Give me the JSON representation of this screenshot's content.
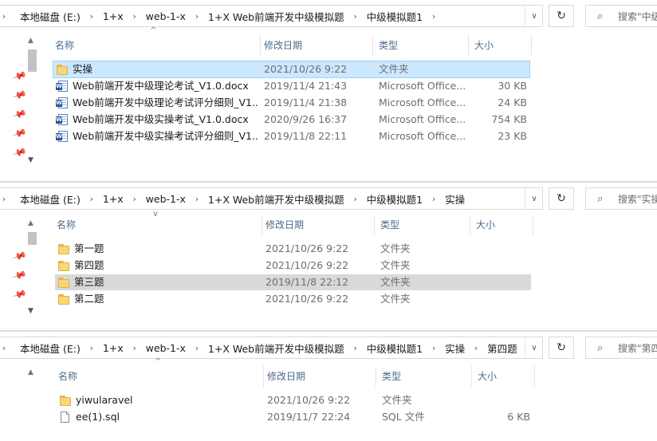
{
  "pane1": {
    "breadcrumb": [
      "本地磁盘 (E:)",
      "1+x",
      "web-1-x",
      "1+X Web前端开发中级模拟题",
      "中级模拟题1"
    ],
    "search_placeholder": "搜索\"中级",
    "columns": {
      "name": "名称",
      "date": "修改日期",
      "type": "类型",
      "size": "大小"
    },
    "rows": [
      {
        "icon": "folder",
        "name": "实操",
        "date": "2021/10/26 9:22",
        "type": "文件夹",
        "size": "",
        "state": "selected"
      },
      {
        "icon": "word",
        "name": "Web前端开发中级理论考试_V1.0.docx",
        "date": "2019/11/4 21:43",
        "type": "Microsoft Office...",
        "size": "30 KB",
        "state": ""
      },
      {
        "icon": "word",
        "name": "Web前端开发中级理论考试评分细则_V1...",
        "date": "2019/11/4 21:38",
        "type": "Microsoft Office...",
        "size": "24 KB",
        "state": ""
      },
      {
        "icon": "word",
        "name": "Web前端开发中级实操考试_V1.0.docx",
        "date": "2020/9/26 16:37",
        "type": "Microsoft Office...",
        "size": "754 KB",
        "state": ""
      },
      {
        "icon": "word",
        "name": "Web前端开发中级实操考试评分细则_V1...",
        "date": "2019/11/8 22:11",
        "type": "Microsoft Office...",
        "size": "23 KB",
        "state": ""
      }
    ]
  },
  "pane2": {
    "breadcrumb": [
      "本地磁盘 (E:)",
      "1+x",
      "web-1-x",
      "1+X Web前端开发中级模拟题",
      "中级模拟题1",
      "实操"
    ],
    "search_placeholder": "搜索\"实操",
    "columns": {
      "name": "名称",
      "date": "修改日期",
      "type": "类型",
      "size": "大小"
    },
    "rows": [
      {
        "icon": "folder",
        "name": "第一题",
        "date": "2021/10/26 9:22",
        "type": "文件夹",
        "size": "",
        "state": ""
      },
      {
        "icon": "folder",
        "name": "第四题",
        "date": "2021/10/26 9:22",
        "type": "文件夹",
        "size": "",
        "state": ""
      },
      {
        "icon": "folder",
        "name": "第三题",
        "date": "2019/11/8 22:12",
        "type": "文件夹",
        "size": "",
        "state": "hover"
      },
      {
        "icon": "folder",
        "name": "第二题",
        "date": "2021/10/26 9:22",
        "type": "文件夹",
        "size": "",
        "state": ""
      }
    ]
  },
  "pane3": {
    "breadcrumb": [
      "本地磁盘 (E:)",
      "1+x",
      "web-1-x",
      "1+X Web前端开发中级模拟题",
      "中级模拟题1",
      "实操",
      "第四题"
    ],
    "search_placeholder": "搜索\"第四",
    "columns": {
      "name": "名称",
      "date": "修改日期",
      "type": "类型",
      "size": "大小"
    },
    "rows": [
      {
        "icon": "folder",
        "name": "yiwularavel",
        "date": "2021/10/26 9:22",
        "type": "文件夹",
        "size": "",
        "state": ""
      },
      {
        "icon": "sql",
        "name": "ee(1).sql",
        "date": "2019/11/7 22:24",
        "type": "SQL 文件",
        "size": "6 KB",
        "state": ""
      }
    ]
  },
  "icons": {
    "chevron": "chevron-right-icon",
    "dropdown": "chevron-down-icon",
    "refresh": "refresh-icon",
    "search": "search-icon",
    "pin": "pin-icon",
    "sort": "sort-up-icon"
  },
  "colors": {
    "selection": "#cce8ff",
    "hover": "#d9d9d9",
    "header_text": "#4d6a8a",
    "folder": "#f8d775"
  }
}
